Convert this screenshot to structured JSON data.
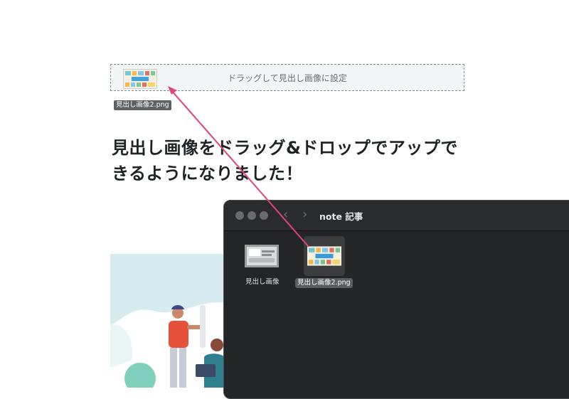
{
  "dropzone": {
    "text": "ドラッグして見出し画像に設定",
    "dragging_file_label": "見出し画像2.png"
  },
  "article": {
    "headline_line1": "見出し画像をドラッグ&ドロップでアップで",
    "headline_line2": "きるようになりました！"
  },
  "finder": {
    "title": "note 記事",
    "files": [
      {
        "name": "見出し画像",
        "selected": false
      },
      {
        "name": "見出し画像2.png",
        "selected": true
      }
    ]
  },
  "colors": {
    "arrow": "#e0457b",
    "finder_bg": "#242526",
    "dropzone_bg": "#f3f6f6"
  }
}
